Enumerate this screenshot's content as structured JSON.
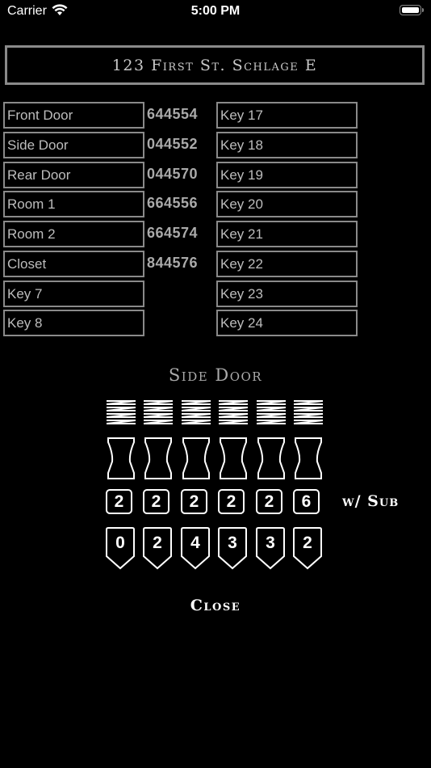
{
  "status_bar": {
    "carrier": "Carrier",
    "time": "5:00 PM"
  },
  "lock_name": "123 First St. Schlage E",
  "keys_left": [
    {
      "label": "Front Door",
      "code": "644554"
    },
    {
      "label": "Side Door",
      "code": "044552"
    },
    {
      "label": "Rear Door",
      "code": "044570"
    },
    {
      "label": "Room 1",
      "code": "664556"
    },
    {
      "label": "Room 2",
      "code": "664574"
    },
    {
      "label": "Closet",
      "code": "844576"
    },
    {
      "label": "Key 7",
      "code": ""
    },
    {
      "label": "Key 8",
      "code": ""
    }
  ],
  "keys_right": [
    "Key 17",
    "Key 18",
    "Key 19",
    "Key 20",
    "Key 21",
    "Key 22",
    "Key 23",
    "Key 24"
  ],
  "selected_key": {
    "title": "Side Door",
    "driver_pins": [
      "2",
      "2",
      "2",
      "2",
      "2",
      "6"
    ],
    "bottom_pins": [
      "0",
      "2",
      "4",
      "3",
      "3",
      "2"
    ],
    "sub_label": "w/ Sub"
  },
  "close_label": "Close"
}
